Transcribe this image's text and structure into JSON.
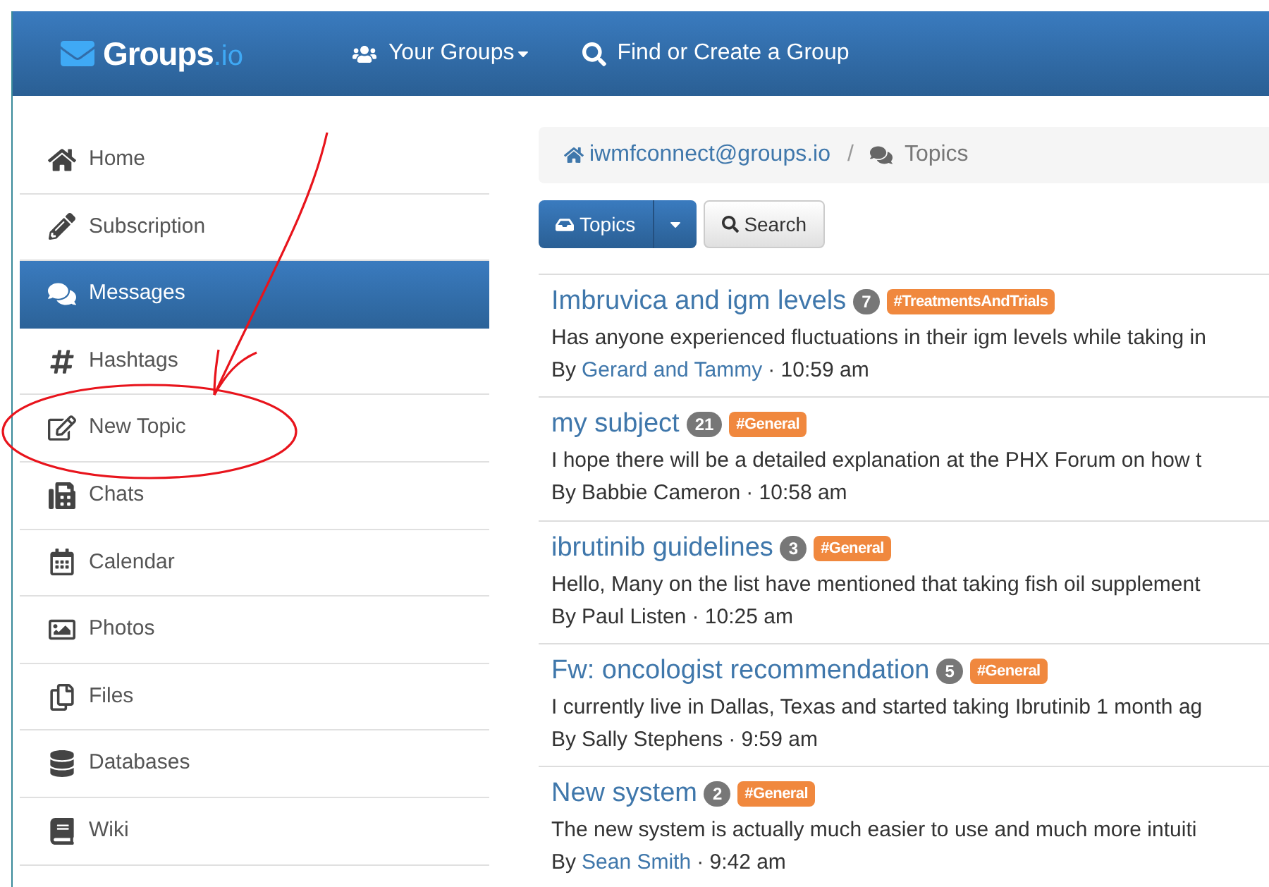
{
  "navbar": {
    "logo_main": "Groups",
    "logo_suffix": ".io",
    "links": [
      {
        "kind": "groups",
        "label": "Your Groups"
      },
      {
        "kind": "search",
        "label": "Find or Create a Group"
      }
    ]
  },
  "sidebar": {
    "items": [
      {
        "kind": "home",
        "label": "Home",
        "selected": false
      },
      {
        "kind": "pencil",
        "label": "Subscription",
        "selected": false
      },
      {
        "kind": "comments",
        "label": "Messages",
        "selected": true
      },
      {
        "kind": "hashtag",
        "label": "Hashtags",
        "selected": false
      },
      {
        "kind": "edit",
        "label": "New Topic",
        "selected": false
      },
      {
        "kind": "phone",
        "label": "Chats",
        "selected": false
      },
      {
        "kind": "calendar",
        "label": "Calendar",
        "selected": false
      },
      {
        "kind": "photo",
        "label": "Photos",
        "selected": false
      },
      {
        "kind": "files",
        "label": "Files",
        "selected": false
      },
      {
        "kind": "database",
        "label": "Databases",
        "selected": false
      },
      {
        "kind": "book",
        "label": "Wiki",
        "selected": false
      }
    ]
  },
  "breadcrumb": {
    "group": "iwmfconnect@groups.io",
    "separator": "/",
    "current": "Topics"
  },
  "toolbar": {
    "topics_button": "Topics",
    "search_button": "Search"
  },
  "topics": [
    {
      "title": "Imbruvica and igm levels",
      "count": "7",
      "hashtag": "#TreatmentsAndTrials",
      "snippet": "Has anyone experienced fluctuations in their igm levels while taking in",
      "by": "By",
      "author": "Gerard and Tammy",
      "author_linked": true,
      "time": "· 10:59 am"
    },
    {
      "title": "my subject",
      "count": "21",
      "hashtag": "#General",
      "snippet": "I hope there will be a detailed explanation at the PHX Forum on how t",
      "by": "By",
      "author": "Babbie Cameron",
      "author_linked": false,
      "time": "· 10:58 am"
    },
    {
      "title": "ibrutinib guidelines",
      "count": "3",
      "hashtag": "#General",
      "snippet": "Hello, Many on the list have mentioned that taking fish oil supplement",
      "by": "By",
      "author": "Paul Listen",
      "author_linked": false,
      "time": "· 10:25 am"
    },
    {
      "title": "Fw: oncologist recommendation",
      "count": "5",
      "hashtag": "#General",
      "snippet": "I currently live in Dallas, Texas and started taking Ibrutinib 1 month ag",
      "by": "By",
      "author": "Sally Stephens",
      "author_linked": false,
      "time": "· 9:59 am"
    },
    {
      "title": "New system",
      "count": "2",
      "hashtag": "#General",
      "snippet": "The new system is actually much easier to use and much more intuiti",
      "by": "By",
      "author": "Sean Smith",
      "author_linked": true,
      "time": "· 9:42 am"
    }
  ]
}
